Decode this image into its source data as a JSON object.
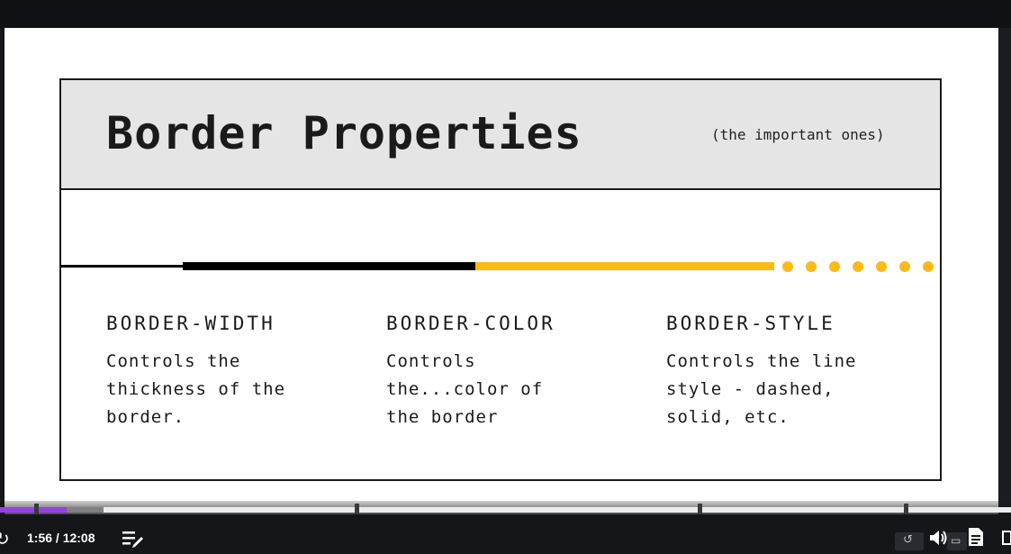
{
  "slide": {
    "title": "Border Properties",
    "subtitle": "(the important ones)",
    "colors": {
      "accent": "#fbba16",
      "line": "#000000",
      "header_bg": "#e5e5e5"
    },
    "columns": [
      {
        "title": "BORDER-WIDTH",
        "text": "Controls the\nthickness of the\nborder."
      },
      {
        "title": "BORDER-COLOR",
        "text": "Controls\nthe...color of\nthe border"
      },
      {
        "title": "BORDER-STYLE",
        "text": "Controls the line\nstyle - dashed,\nsolid, etc."
      }
    ]
  },
  "player": {
    "time": "1:56 / 12:08",
    "progress_fraction": 0.16,
    "accent_color": "#9b3ee8",
    "icons": [
      "replay-icon",
      "chapters-icon",
      "rewind-icon",
      "volume-icon",
      "picture-in-picture-icon",
      "transcript-icon",
      "fullscreen-icon"
    ]
  }
}
